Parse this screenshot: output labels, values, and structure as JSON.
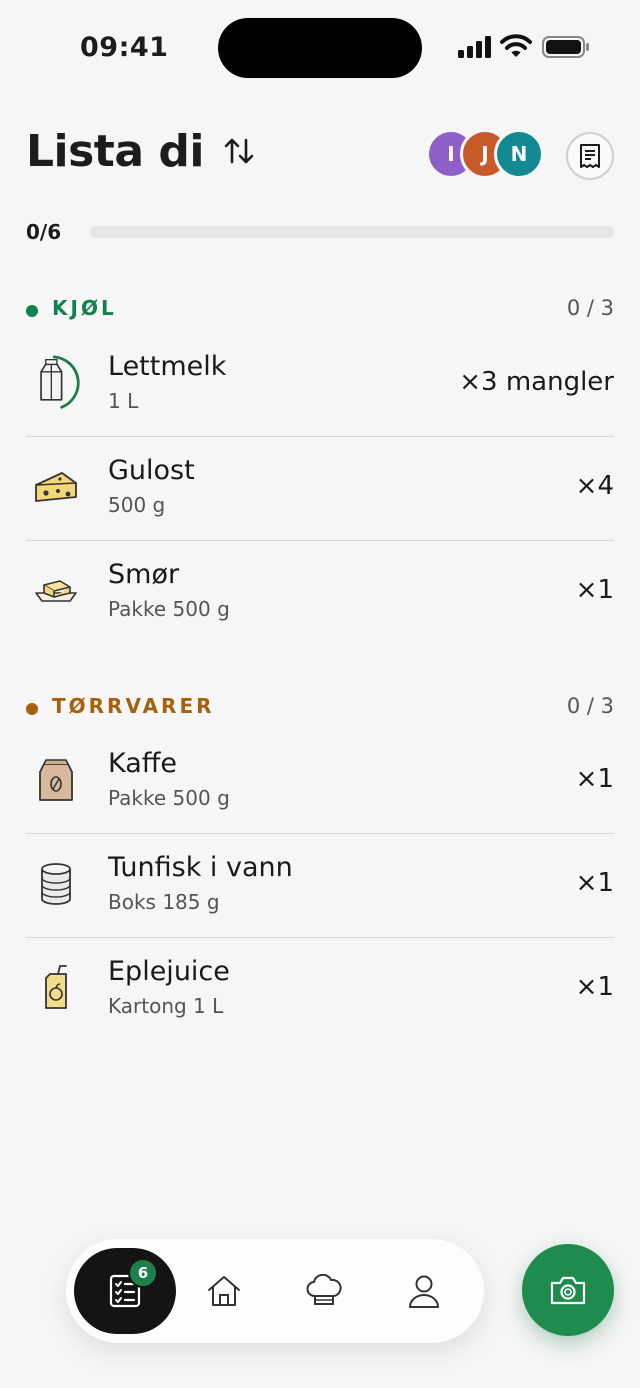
{
  "status_bar": {
    "time": "09:41"
  },
  "header": {
    "title": "Lista di",
    "avatars": [
      {
        "initial": "I",
        "color": "#8e5fc8"
      },
      {
        "initial": "J",
        "color": "#c65a28"
      },
      {
        "initial": "N",
        "color": "#138992"
      }
    ],
    "sort_icon": "sort-arrows-icon",
    "receipt_icon": "receipt-icon"
  },
  "progress": {
    "label": "0/6",
    "fraction": 0
  },
  "sections": [
    {
      "title": "KJØL",
      "count": "0 / 3",
      "color": "#14804f",
      "items": [
        {
          "name": "Lettmelk",
          "sub": "1 L",
          "qty": "×3 mangler",
          "icon": "milk-carton-icon",
          "partial": true
        },
        {
          "name": "Gulost",
          "sub": "500 g",
          "qty": "×4",
          "icon": "cheese-icon"
        },
        {
          "name": "Smør",
          "sub": "Pakke 500 g",
          "qty": "×1",
          "icon": "butter-icon"
        }
      ]
    },
    {
      "title": "TØRRVARER",
      "count": "0 / 3",
      "color": "#a4620e",
      "items": [
        {
          "name": "Kaffe",
          "sub": "Pakke 500 g",
          "qty": "×1",
          "icon": "coffee-bag-icon"
        },
        {
          "name": "Tunfisk i vann",
          "sub": "Boks 185 g",
          "qty": "×1",
          "icon": "tin-can-icon"
        },
        {
          "name": "Eplejuice",
          "sub": "Kartong 1 L",
          "qty": "×1",
          "icon": "juice-box-icon"
        }
      ]
    }
  ],
  "bottom_nav": {
    "badge": "6",
    "items": [
      "list-icon",
      "home-icon",
      "chef-hat-icon",
      "profile-icon"
    ]
  },
  "fab_icon": "camera-icon"
}
